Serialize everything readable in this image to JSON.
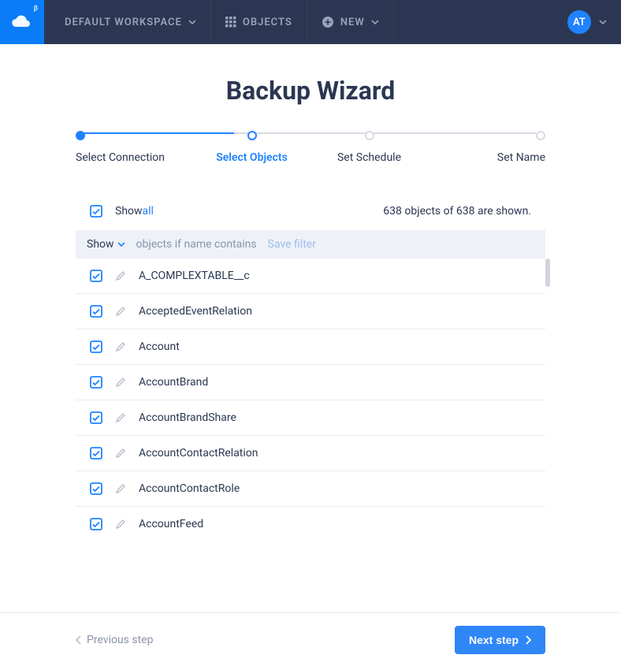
{
  "topbar": {
    "workspace_label": "DEFAULT WORKSPACE",
    "objects_label": "OBJECTS",
    "new_label": "NEW",
    "user_initials": "AT",
    "logo_badge": "β"
  },
  "page": {
    "title": "Backup Wizard"
  },
  "stepper": {
    "step1": "Select Connection",
    "step2": "Select Objects",
    "step3": "Set Schedule",
    "step4": "Set Name"
  },
  "show_row": {
    "show_label": "Show ",
    "all_link": "all",
    "count_text": "638 objects of 638 are shown."
  },
  "filter": {
    "show_label": "Show",
    "hint": "objects if name contains",
    "save_label": "Save filter"
  },
  "objects": [
    {
      "name": "A_COMPLEXTABLE__c"
    },
    {
      "name": "AcceptedEventRelation"
    },
    {
      "name": "Account"
    },
    {
      "name": "AccountBrand"
    },
    {
      "name": "AccountBrandShare"
    },
    {
      "name": "AccountContactRelation"
    },
    {
      "name": "AccountContactRole"
    },
    {
      "name": "AccountFeed"
    }
  ],
  "footer": {
    "prev_label": "Previous step",
    "next_label": "Next step"
  }
}
